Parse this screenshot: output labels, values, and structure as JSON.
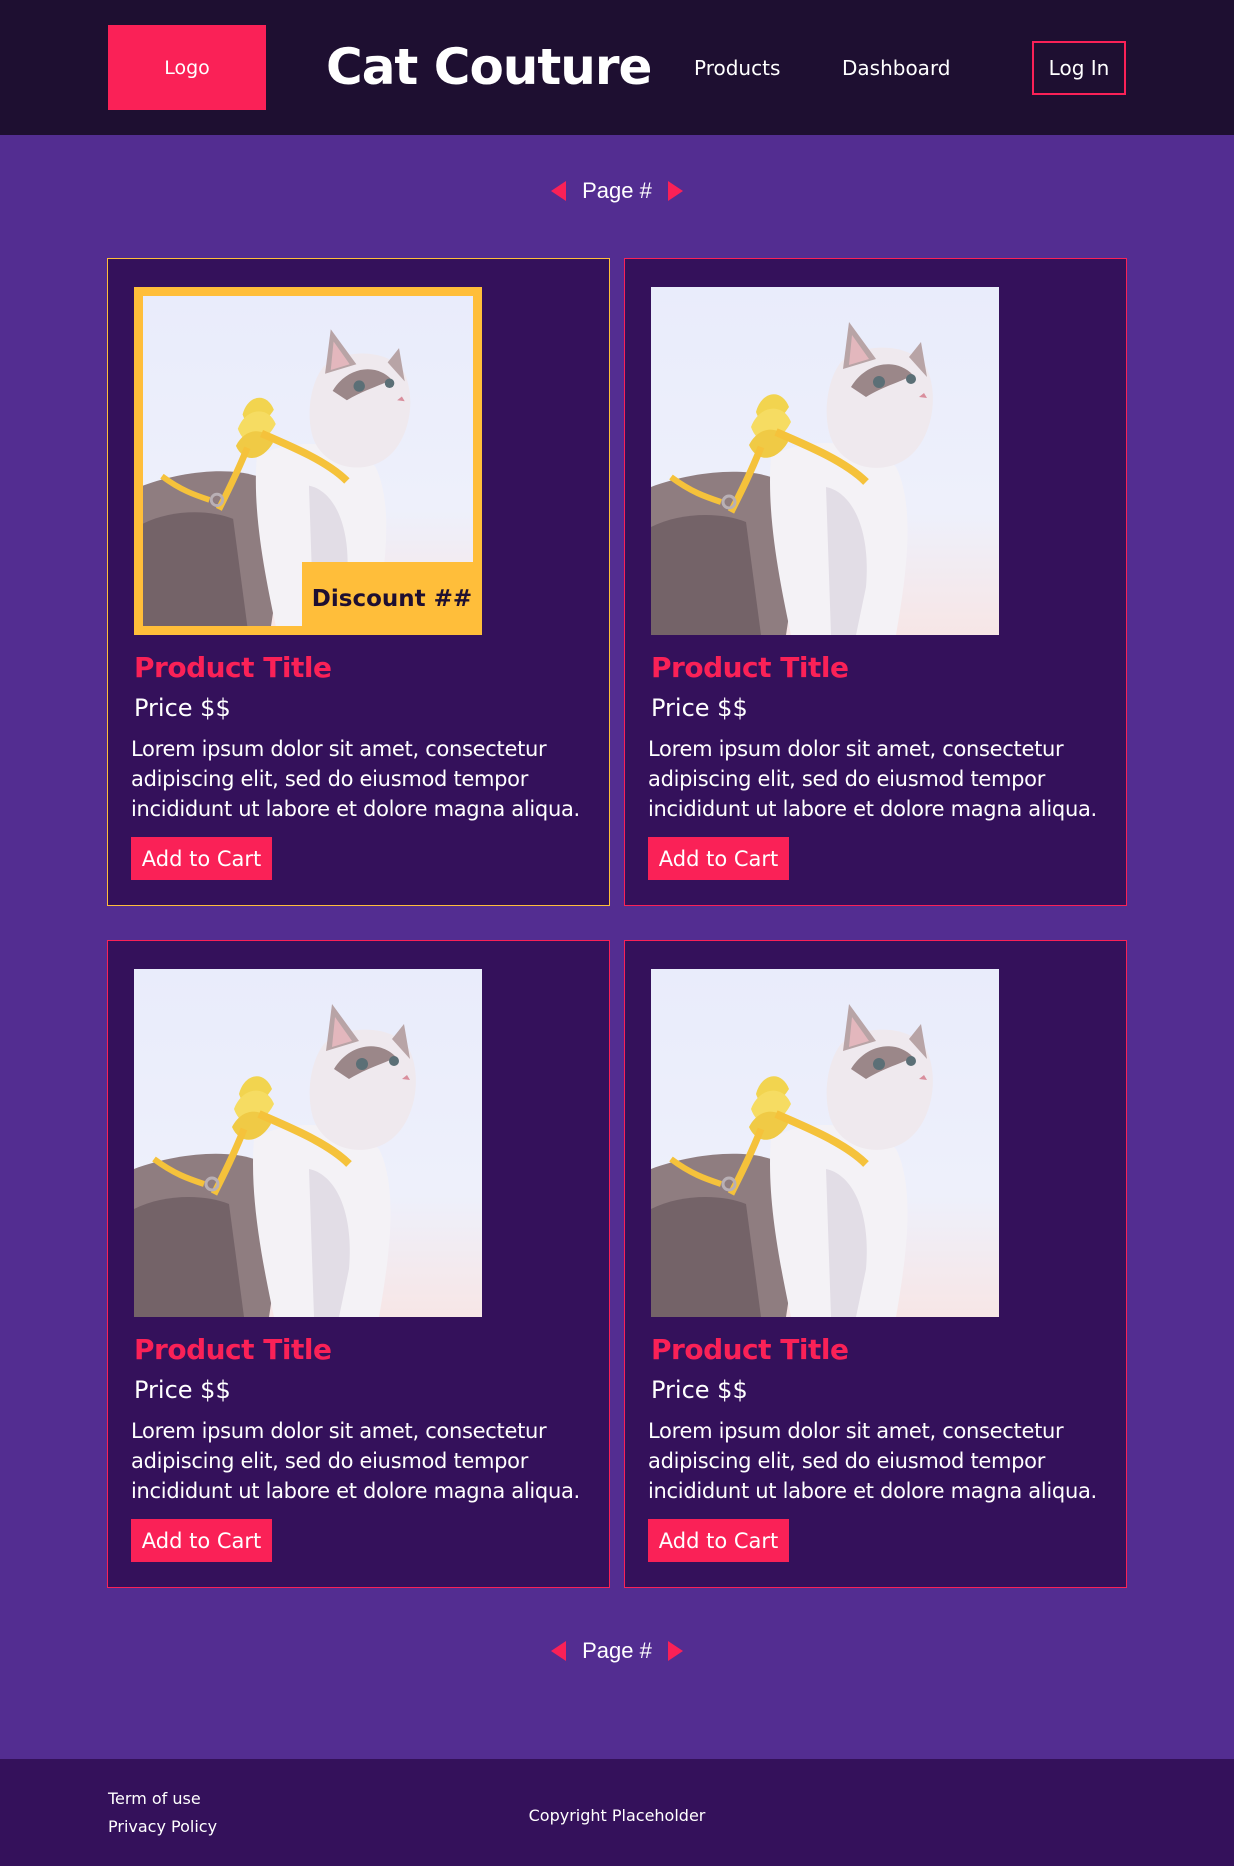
{
  "header": {
    "logo": "Logo",
    "title": "Cat Couture",
    "nav": [
      "Products",
      "Dashboard"
    ],
    "login": "Log In"
  },
  "pager": {
    "label": "Page #"
  },
  "products": [
    {
      "title": "Product Title",
      "price": "Price $$",
      "description": "Lorem ipsum dolor sit amet, consectetur adipiscing elit, sed do eiusmod tempor incididunt ut labore et dolore magna aliqua.",
      "button": "Add to Cart",
      "discount": "Discount ##"
    },
    {
      "title": "Product Title",
      "price": "Price $$",
      "description": "Lorem ipsum dolor sit amet, consectetur adipiscing elit, sed do eiusmod tempor incididunt ut labore et dolore magna aliqua.",
      "button": "Add to Cart"
    },
    {
      "title": "Product Title",
      "price": "Price $$",
      "description": "Lorem ipsum dolor sit amet, consectetur adipiscing elit, sed do eiusmod tempor incididunt ut labore et dolore magna aliqua.",
      "button": "Add to Cart"
    },
    {
      "title": "Product Title",
      "price": "Price $$",
      "description": "Lorem ipsum dolor sit amet, consectetur adipiscing elit, sed do eiusmod tempor incididunt ut labore et dolore magna aliqua.",
      "button": "Add to Cart"
    }
  ],
  "footer": {
    "terms": "Term of use",
    "privacy": "Privacy Policy",
    "copyright": "Copyright Placeholder"
  },
  "colors": {
    "page_bg": "#532d91",
    "header_bg": "#1e0f31",
    "card_bg": "#34115b",
    "accent": "#fa2157",
    "discount": "#ffbe3a"
  },
  "icons": [
    "prev-page-icon",
    "next-page-icon",
    "cat-product-image"
  ]
}
